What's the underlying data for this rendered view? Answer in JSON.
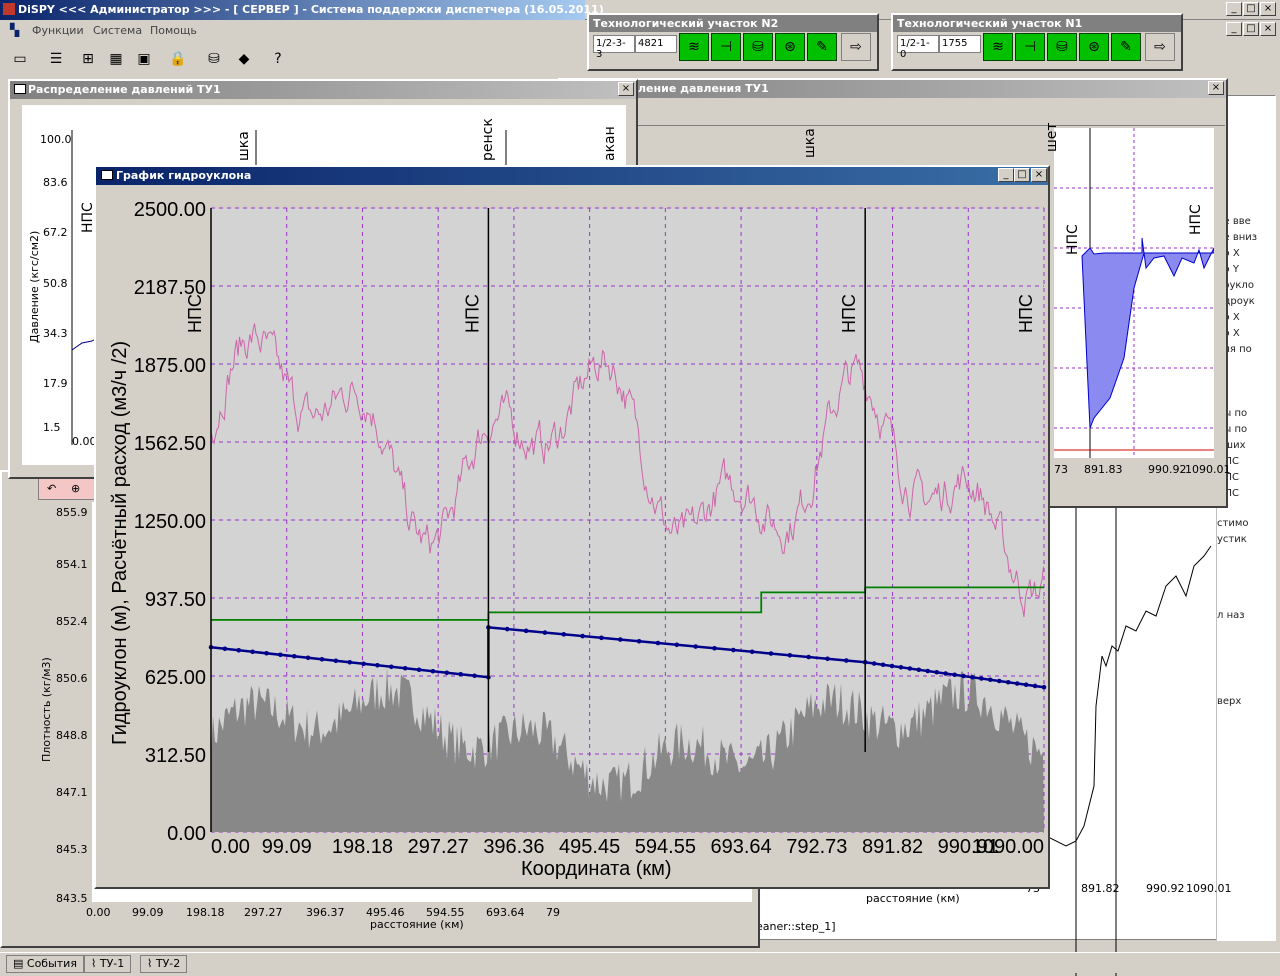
{
  "app": {
    "title": "DiSPY <<< Администратор >>> - [ СЕРВЕР ] - Система поддержки диспетчера (16.05.2011)",
    "menu": [
      "Функции",
      "Система",
      "Помощь"
    ]
  },
  "tech_panels": [
    {
      "title": "Технологический участок N2",
      "code": "1/2-3-3",
      "value": "4821"
    },
    {
      "title": "Технологический участок N1",
      "code": "1/2-1-0",
      "value": "1755"
    }
  ],
  "pressure_window": {
    "title": "Распределение давлений ТУ1",
    "y_ticks": [
      "100.0",
      "83.6",
      "67.2",
      "50.8",
      "34.3",
      "17.9",
      "1.5"
    ],
    "ylabel": "Давление (кгс/см2)",
    "first_x": "0.00",
    "station_labels": [
      "НПС",
      "шка",
      "ренск",
      "акан"
    ]
  },
  "pressure_window2": {
    "title": "ление давления ТУ1",
    "x_ticks": [
      "73",
      "891.83",
      "990.92",
      "1090.01"
    ],
    "station_labels": [
      "шет",
      "шка",
      "НПС",
      "НПС"
    ]
  },
  "density_window": {
    "y_ticks": [
      "855.9",
      "854.1",
      "852.4",
      "850.6",
      "848.8",
      "847.1",
      "845.3",
      "843.5"
    ],
    "ylabel": "Плотность (кг/м3)",
    "x_ticks": [
      "0.00",
      "99.09",
      "198.18",
      "297.27",
      "396.37",
      "495.46",
      "594.55",
      "693.64",
      "79"
    ],
    "xlabel": "расстояние (км)"
  },
  "right_window": {
    "x_ticks": [
      "73",
      "891.82",
      "990.92",
      "1090.01"
    ],
    "xlabel": "расстояние (км)",
    "station_labels": [
      "НПС Киренск",
      "НПС Талакан"
    ],
    "side_text": [
      "ие вве",
      "ие вниз",
      "по X",
      "по Y",
      "роукло",
      "идроук",
      "по X",
      "по X",
      "иля по",
      "лы по",
      "лы по",
      "дших",
      "НПС",
      "НПС",
      "НПС",
      "стимо",
      "устик",
      "л наз",
      "верх"
    ],
    "bottom_text": "eaner::step_1]"
  },
  "main_window": {
    "title": "График гидроуклона",
    "ylabel": "Гидроуклон (м), Расчётный расход (м3/ч /2)",
    "xlabel": "Координата (км)",
    "y_ticks": [
      "2500.00",
      "2187.50",
      "1875.00",
      "1562.50",
      "1250.00",
      "937.50",
      "625.00",
      "312.50",
      "0.00"
    ],
    "x_ticks": [
      "0.00",
      "99.09",
      "198.18",
      "297.27",
      "396.36",
      "495.45",
      "594.55",
      "693.64",
      "792.73",
      "891.82",
      "990.91",
      "1090.00"
    ],
    "station_labels": [
      "НПС",
      "НПС",
      "НПС",
      "НПС"
    ]
  },
  "chart_data": {
    "type": "line",
    "xlabel": "Координата (км)",
    "ylabel": "Гидроуклон (м), Расчётный расход (м3/ч /2)",
    "xlim": [
      0,
      1090
    ],
    "ylim": [
      0,
      2500
    ],
    "stations_km": [
      0,
      363,
      856,
      1090
    ],
    "series": [
      {
        "x": [
          0,
          363,
          363,
          720,
          720,
          856,
          856,
          1090
        ],
        "y": [
          850,
          850,
          880,
          880,
          960,
          960,
          980,
          980
        ],
        "color": "#008000"
      },
      {
        "x": [
          0,
          363,
          363,
          856,
          856,
          1090
        ],
        "y": [
          740,
          620,
          820,
          680,
          680,
          580
        ],
        "color": "#00008b"
      }
    ],
    "grid": true
  },
  "statusbar": {
    "tabs": [
      "События",
      "ТУ-1",
      "ТУ-2"
    ]
  },
  "colors": {
    "title_active": "#0a246a",
    "plot_bg": "#d3d3d3",
    "grid": "#9932cc",
    "pink_line": "#cc66aa",
    "green_line": "#008000",
    "blue_line": "#00008b",
    "gray_area": "#888888",
    "fill_blue": "#8a8af0"
  }
}
